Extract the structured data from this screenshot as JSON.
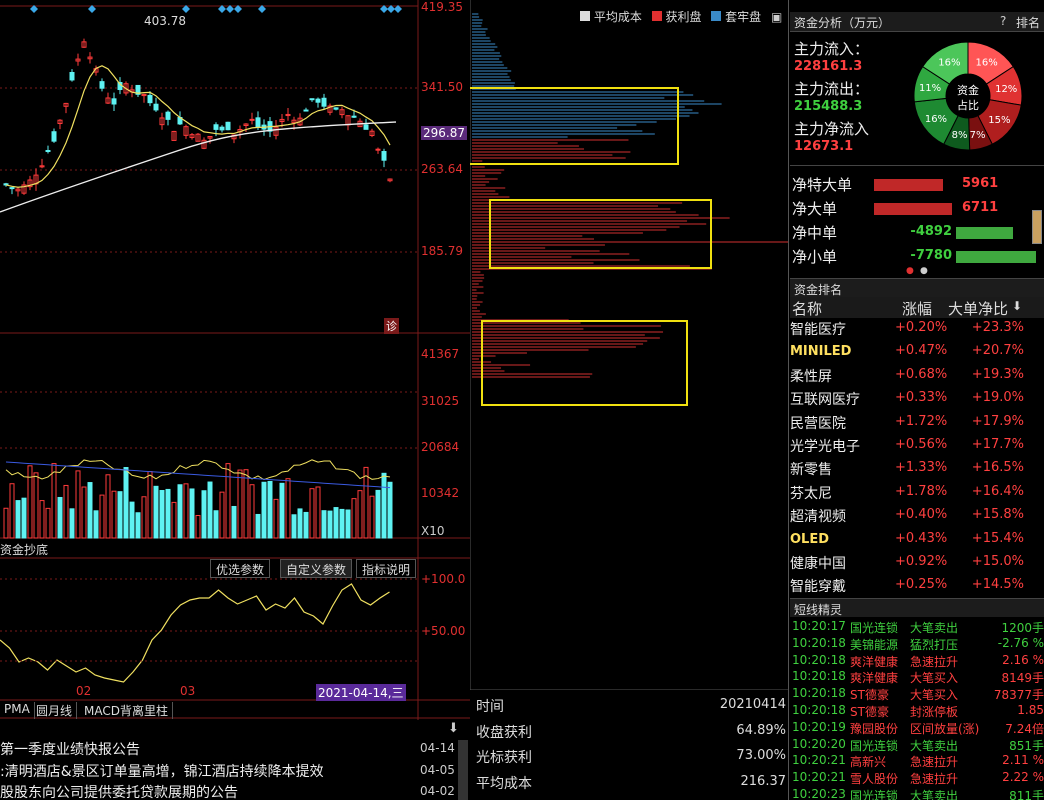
{
  "colors": {
    "red": "#ff3b3b",
    "cyan": "#5ef2f2",
    "yellow": "#f5e050",
    "green": "#3fbf3f",
    "blue": "#4a86c5"
  },
  "kline": {
    "price_labels": [
      "419.35",
      "341.50",
      "296.87",
      "263.64",
      "185.79"
    ],
    "high_annotation": "403.78",
    "diag_label": "诊"
  },
  "volume": {
    "labels": [
      "41367",
      "31025",
      "20684",
      "10342"
    ],
    "multiplier": "X10"
  },
  "indicator": {
    "title": "资金抄底",
    "buttons": [
      "优选参数",
      "自定义参数",
      "指标说明"
    ],
    "labels": [
      "+100.0",
      "+50.00"
    ],
    "x_labels": [
      "02",
      "03"
    ],
    "cursor_date": "2021-04-14,三"
  },
  "bottom_tabs": [
    "PMA",
    "圆月线",
    "MACD背离里柱"
  ],
  "news": [
    {
      "text": "第一季度业绩快报公告",
      "date": "04-14"
    },
    {
      "text": ":清明酒店&景区订单量高增，锦江酒店持续降本提效",
      "date": "04-05"
    },
    {
      "text": "股股东向公司提供委托贷款展期的公告",
      "date": "04-02"
    }
  ],
  "chip": {
    "legend": {
      "avg": "平均成本",
      "profit": "获利盘",
      "locked": "套牢盘"
    },
    "stats": [
      {
        "label": "时间",
        "value": "20210414"
      },
      {
        "label": "收盘获利",
        "value": "64.89%"
      },
      {
        "label": "光标获利",
        "value": "73.00%"
      },
      {
        "label": "平均成本",
        "value": "216.37"
      }
    ]
  },
  "fund": {
    "header_title": "资金分析（万元）",
    "header_help": "?",
    "header_rank": "排名",
    "inflow_label": "主力流入：",
    "inflow_value": "228161.3",
    "outflow_label": "主力流出：",
    "outflow_value": "215488.3",
    "net_label": "主力净流入",
    "net_value": "12673.1",
    "donut_center": [
      "资金",
      "占比"
    ],
    "donut_slices": [
      {
        "label": "16%",
        "value": 16,
        "color": "#ff5555"
      },
      {
        "label": "12%",
        "value": 12,
        "color": "#e03232"
      },
      {
        "label": "15%",
        "value": 15,
        "color": "#b01e1e"
      },
      {
        "label": "7%",
        "value": 7,
        "color": "#7a1010"
      },
      {
        "label": "8%",
        "value": 8,
        "color": "#0e5a1e"
      },
      {
        "label": "16%",
        "value": 16,
        "color": "#1e8a32"
      },
      {
        "label": "11%",
        "value": 11,
        "color": "#2fa840"
      },
      {
        "label": "16%",
        "value": 16,
        "color": "#4cc65a"
      }
    ],
    "flows": [
      {
        "label": "净特大单",
        "value": "5961",
        "amount": 5961
      },
      {
        "label": "净大单",
        "value": "6711",
        "amount": 6711
      },
      {
        "label": "净中单",
        "value": "-4892",
        "amount": -4892
      },
      {
        "label": "净小单",
        "value": "-7780",
        "amount": -7780
      }
    ]
  },
  "ranking": {
    "title": "资金排名",
    "columns": [
      "名称",
      "涨幅",
      "大单净比"
    ],
    "rows": [
      {
        "name": "智能医疗",
        "chg": "+0.20%",
        "ratio": "+23.3%",
        "hl": false
      },
      {
        "name": "MINILED",
        "chg": "+0.47%",
        "ratio": "+20.7%",
        "hl": true
      },
      {
        "name": "柔性屏",
        "chg": "+0.68%",
        "ratio": "+19.3%",
        "hl": false
      },
      {
        "name": "互联网医疗",
        "chg": "+0.33%",
        "ratio": "+19.0%",
        "hl": false
      },
      {
        "name": "民营医院",
        "chg": "+1.72%",
        "ratio": "+17.9%",
        "hl": false
      },
      {
        "name": "光学光电子",
        "chg": "+0.56%",
        "ratio": "+17.7%",
        "hl": false
      },
      {
        "name": "新零售",
        "chg": "+1.33%",
        "ratio": "+16.5%",
        "hl": false
      },
      {
        "name": "芬太尼",
        "chg": "+1.78%",
        "ratio": "+16.4%",
        "hl": false
      },
      {
        "name": "超清视频",
        "chg": "+0.40%",
        "ratio": "+15.8%",
        "hl": false
      },
      {
        "name": "OLED",
        "chg": "+0.43%",
        "ratio": "+15.4%",
        "hl": true
      },
      {
        "name": "健康中国",
        "chg": "+0.92%",
        "ratio": "+15.0%",
        "hl": false
      },
      {
        "name": "智能穿戴",
        "chg": "+0.25%",
        "ratio": "+14.5%",
        "hl": false
      }
    ]
  },
  "sprite": {
    "title": "短线精灵",
    "rows": [
      {
        "time": "10:20:17",
        "name": "国光连锁",
        "type": "大笔卖出",
        "val": "1200手",
        "c": "g"
      },
      {
        "time": "10:20:18",
        "name": "美锦能源",
        "type": "猛烈打压",
        "val": "-2.76 %",
        "c": "g"
      },
      {
        "time": "10:20:18",
        "name": "爽洋健康",
        "type": "急速拉升",
        "val": "2.16 %",
        "c": "r"
      },
      {
        "time": "10:20:18",
        "name": "爽洋健康",
        "type": "大笔买入",
        "val": "8149手",
        "c": "r"
      },
      {
        "time": "10:20:18",
        "name": "ST德豪",
        "type": "大笔买入",
        "val": "78377手",
        "c": "r"
      },
      {
        "time": "10:20:18",
        "name": "ST德豪",
        "type": "封涨停板",
        "val": "1.85",
        "c": "r"
      },
      {
        "time": "10:20:19",
        "name": "豫园股份",
        "type": "区间放量(涨)",
        "val": "7.24倍",
        "c": "r"
      },
      {
        "time": "10:20:20",
        "name": "国光连锁",
        "type": "大笔卖出",
        "val": "851手",
        "c": "g"
      },
      {
        "time": "10:20:21",
        "name": "高新兴",
        "type": "急速拉升",
        "val": "2.11 %",
        "c": "r"
      },
      {
        "time": "10:20:21",
        "name": "雪人股份",
        "type": "急速拉升",
        "val": "2.22 %",
        "c": "r"
      },
      {
        "time": "10:20:23",
        "name": "国光连锁",
        "type": "大笔卖出",
        "val": "811手",
        "c": "g"
      }
    ]
  }
}
